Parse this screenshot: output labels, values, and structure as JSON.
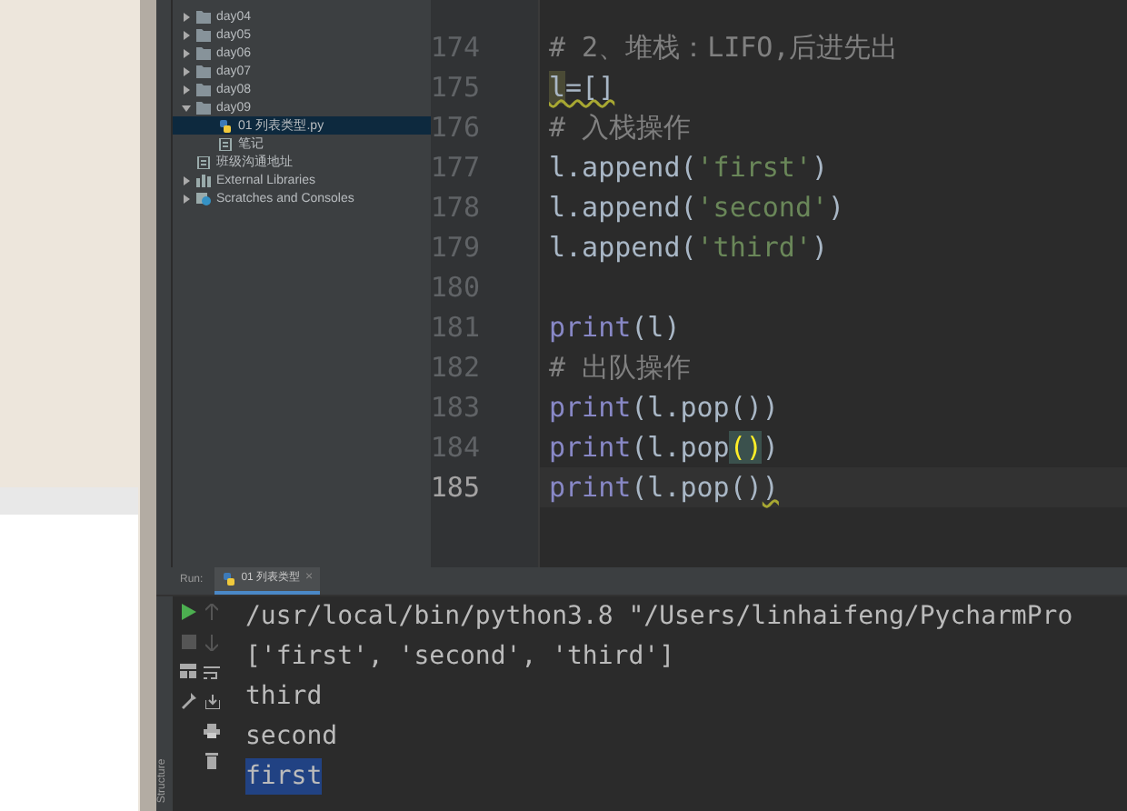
{
  "project_tree": [
    {
      "label": "day04",
      "kind": "folder",
      "expanded": false,
      "selected": false
    },
    {
      "label": "day05",
      "kind": "folder",
      "expanded": false,
      "selected": false
    },
    {
      "label": "day06",
      "kind": "folder",
      "expanded": false,
      "selected": false
    },
    {
      "label": "day07",
      "kind": "folder",
      "expanded": false,
      "selected": false
    },
    {
      "label": "day08",
      "kind": "folder",
      "expanded": false,
      "selected": false
    },
    {
      "label": "day09",
      "kind": "folder",
      "expanded": true,
      "selected": false,
      "children": [
        {
          "label": "01 列表类型.py",
          "kind": "python",
          "selected": true
        },
        {
          "label": "笔记",
          "kind": "text",
          "selected": false
        }
      ]
    },
    {
      "label": "班级沟通地址",
      "kind": "text",
      "selected": false
    },
    {
      "label": "External Libraries",
      "kind": "library",
      "expanded": false,
      "selected": false
    },
    {
      "label": "Scratches and Consoles",
      "kind": "scratch",
      "expanded": false,
      "selected": false
    }
  ],
  "editor": {
    "lines": [
      {
        "number": "174",
        "current": false,
        "tokens": [
          {
            "text": "# 2、堆栈：LIFO,后进先出",
            "kind": "comment"
          }
        ]
      },
      {
        "number": "175",
        "current": false,
        "tokens": [
          {
            "text": "l",
            "kind": "warn_highlight"
          },
          {
            "text": "=[]",
            "kind": "warn"
          }
        ]
      },
      {
        "number": "176",
        "current": false,
        "tokens": [
          {
            "text": "# 入栈操作",
            "kind": "comment"
          }
        ]
      },
      {
        "number": "177",
        "current": false,
        "tokens": [
          {
            "text": "l.append(",
            "kind": "plain"
          },
          {
            "text": "'first'",
            "kind": "string"
          },
          {
            "text": ")",
            "kind": "plain"
          }
        ]
      },
      {
        "number": "178",
        "current": false,
        "tokens": [
          {
            "text": "l.append(",
            "kind": "plain"
          },
          {
            "text": "'second'",
            "kind": "string"
          },
          {
            "text": ")",
            "kind": "plain"
          }
        ]
      },
      {
        "number": "179",
        "current": false,
        "tokens": [
          {
            "text": "l.append(",
            "kind": "plain"
          },
          {
            "text": "'third'",
            "kind": "string"
          },
          {
            "text": ")",
            "kind": "plain"
          }
        ]
      },
      {
        "number": "180",
        "current": false
      },
      {
        "number": "181",
        "current": false,
        "tokens": [
          {
            "text": "print",
            "kind": "builtin"
          },
          {
            "text": "(l)",
            "kind": "plain"
          }
        ]
      },
      {
        "number": "182",
        "current": false,
        "tokens": [
          {
            "text": "# 出队操作",
            "kind": "comment"
          }
        ]
      },
      {
        "number": "183",
        "current": false,
        "tokens": [
          {
            "text": "print",
            "kind": "builtin"
          },
          {
            "text": "(l.pop())",
            "kind": "plain"
          }
        ]
      },
      {
        "number": "184",
        "current": false,
        "tokens": [
          {
            "text": "print",
            "kind": "builtin"
          },
          {
            "text": "(l.pop",
            "kind": "plain"
          },
          {
            "text": "()",
            "kind": "match"
          },
          {
            "text": ")",
            "kind": "plain"
          }
        ]
      },
      {
        "number": "185",
        "current": true,
        "tokens": [
          {
            "text": "print",
            "kind": "builtin"
          },
          {
            "text": "(l.pop()",
            "kind": "plain"
          },
          {
            "text": ")",
            "kind": "warn"
          }
        ]
      }
    ]
  },
  "run_panel": {
    "label": "Run:",
    "tab": {
      "title": "01 列表类型",
      "close": "×"
    },
    "output": [
      {
        "text": "/usr/local/bin/python3.8 \"/Users/linhaifeng/PycharmPro",
        "selected": false
      },
      {
        "text": "['first', 'second', 'third']",
        "selected": false
      },
      {
        "text": "third",
        "selected": false
      },
      {
        "text": "second",
        "selected": false
      },
      {
        "text": "first",
        "selected": true
      }
    ]
  },
  "side_tab": "Structure"
}
